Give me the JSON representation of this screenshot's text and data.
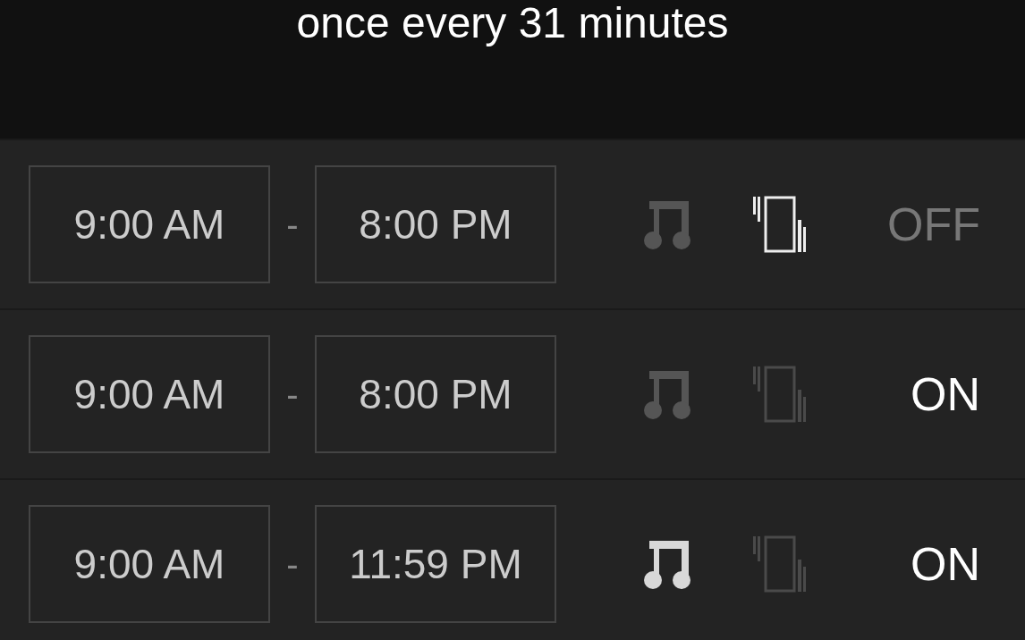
{
  "header": {
    "text": "once every 31 minutes"
  },
  "rows": [
    {
      "start": "9:00 AM",
      "separator": "-",
      "end": "8:00 PM",
      "sound": false,
      "vibrate": true,
      "on": false,
      "status": "OFF"
    },
    {
      "start": "9:00 AM",
      "separator": "-",
      "end": "8:00 PM",
      "sound": false,
      "vibrate": false,
      "on": true,
      "status": "ON"
    },
    {
      "start": "9:00 AM",
      "separator": "-",
      "end": "11:59 PM",
      "sound": true,
      "vibrate": false,
      "on": true,
      "status": "ON"
    }
  ]
}
